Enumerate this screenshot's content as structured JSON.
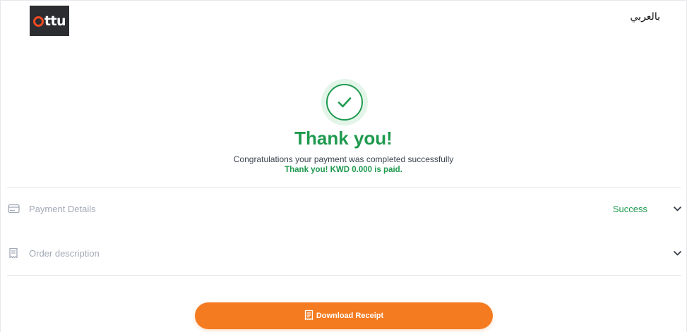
{
  "header": {
    "logo_text": "ttu",
    "language_link": "بالعربي"
  },
  "confirmation": {
    "title": "Thank you!",
    "message": "Congratulations your payment was completed successfully",
    "paid_text": "Thank you! KWD 0.000 is paid."
  },
  "payment_details": {
    "label": "Payment Details",
    "status": "Success",
    "icon": "card-icon"
  },
  "order_description": {
    "label": "Order description",
    "icon": "receipt-icon"
  },
  "actions": {
    "download_label": "Download Receipt",
    "icon": "receipt-icon"
  },
  "colors": {
    "brand_orange": "#f47b20",
    "success_green": "#1f9a4f",
    "logo_bg": "#2b2d31",
    "logo_accent": "#ef4a23"
  }
}
